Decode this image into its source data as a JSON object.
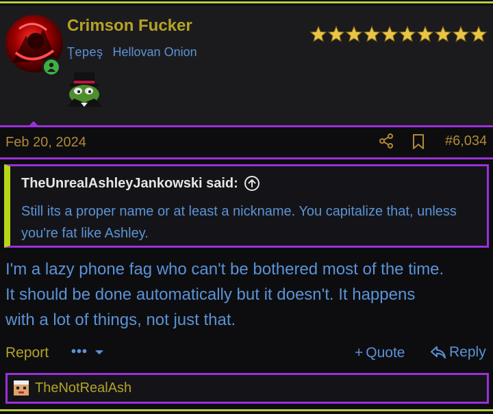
{
  "user": {
    "name": "Crimson Fucker",
    "title_primary": "Ţepeş",
    "title_secondary": "Hellovan Onion",
    "stars": 10
  },
  "post": {
    "date": "Feb 20, 2024",
    "number": "#6,034",
    "quote": {
      "author": "TheUnrealAshleyJankowski said:",
      "text": "Still its a proper name or at least a nickname. You capitalize that, unless you're fat like Ashley."
    },
    "body_lines": [
      "I'm a lazy phone fag who can't be bothered most of the time.",
      "It should be done automatically but it doesn't. It happens",
      "with a lot of things, not just that."
    ]
  },
  "actions": {
    "report": "Report",
    "more": "•••",
    "quote": "Quote",
    "quote_prefix": "+",
    "reply": "Reply"
  },
  "reactions": {
    "user": "TheNotRealAsh"
  },
  "colors": {
    "accent_purple": "#9b30d9",
    "accent_lime": "#b6d617",
    "gold": "#b5a326",
    "link_blue": "#5b93d6"
  },
  "icons": [
    "online-status-icon",
    "star-icon",
    "share-icon",
    "bookmark-icon",
    "quote-jump-icon",
    "chevron-down-icon",
    "reply-icon",
    "reaction-icon"
  ]
}
